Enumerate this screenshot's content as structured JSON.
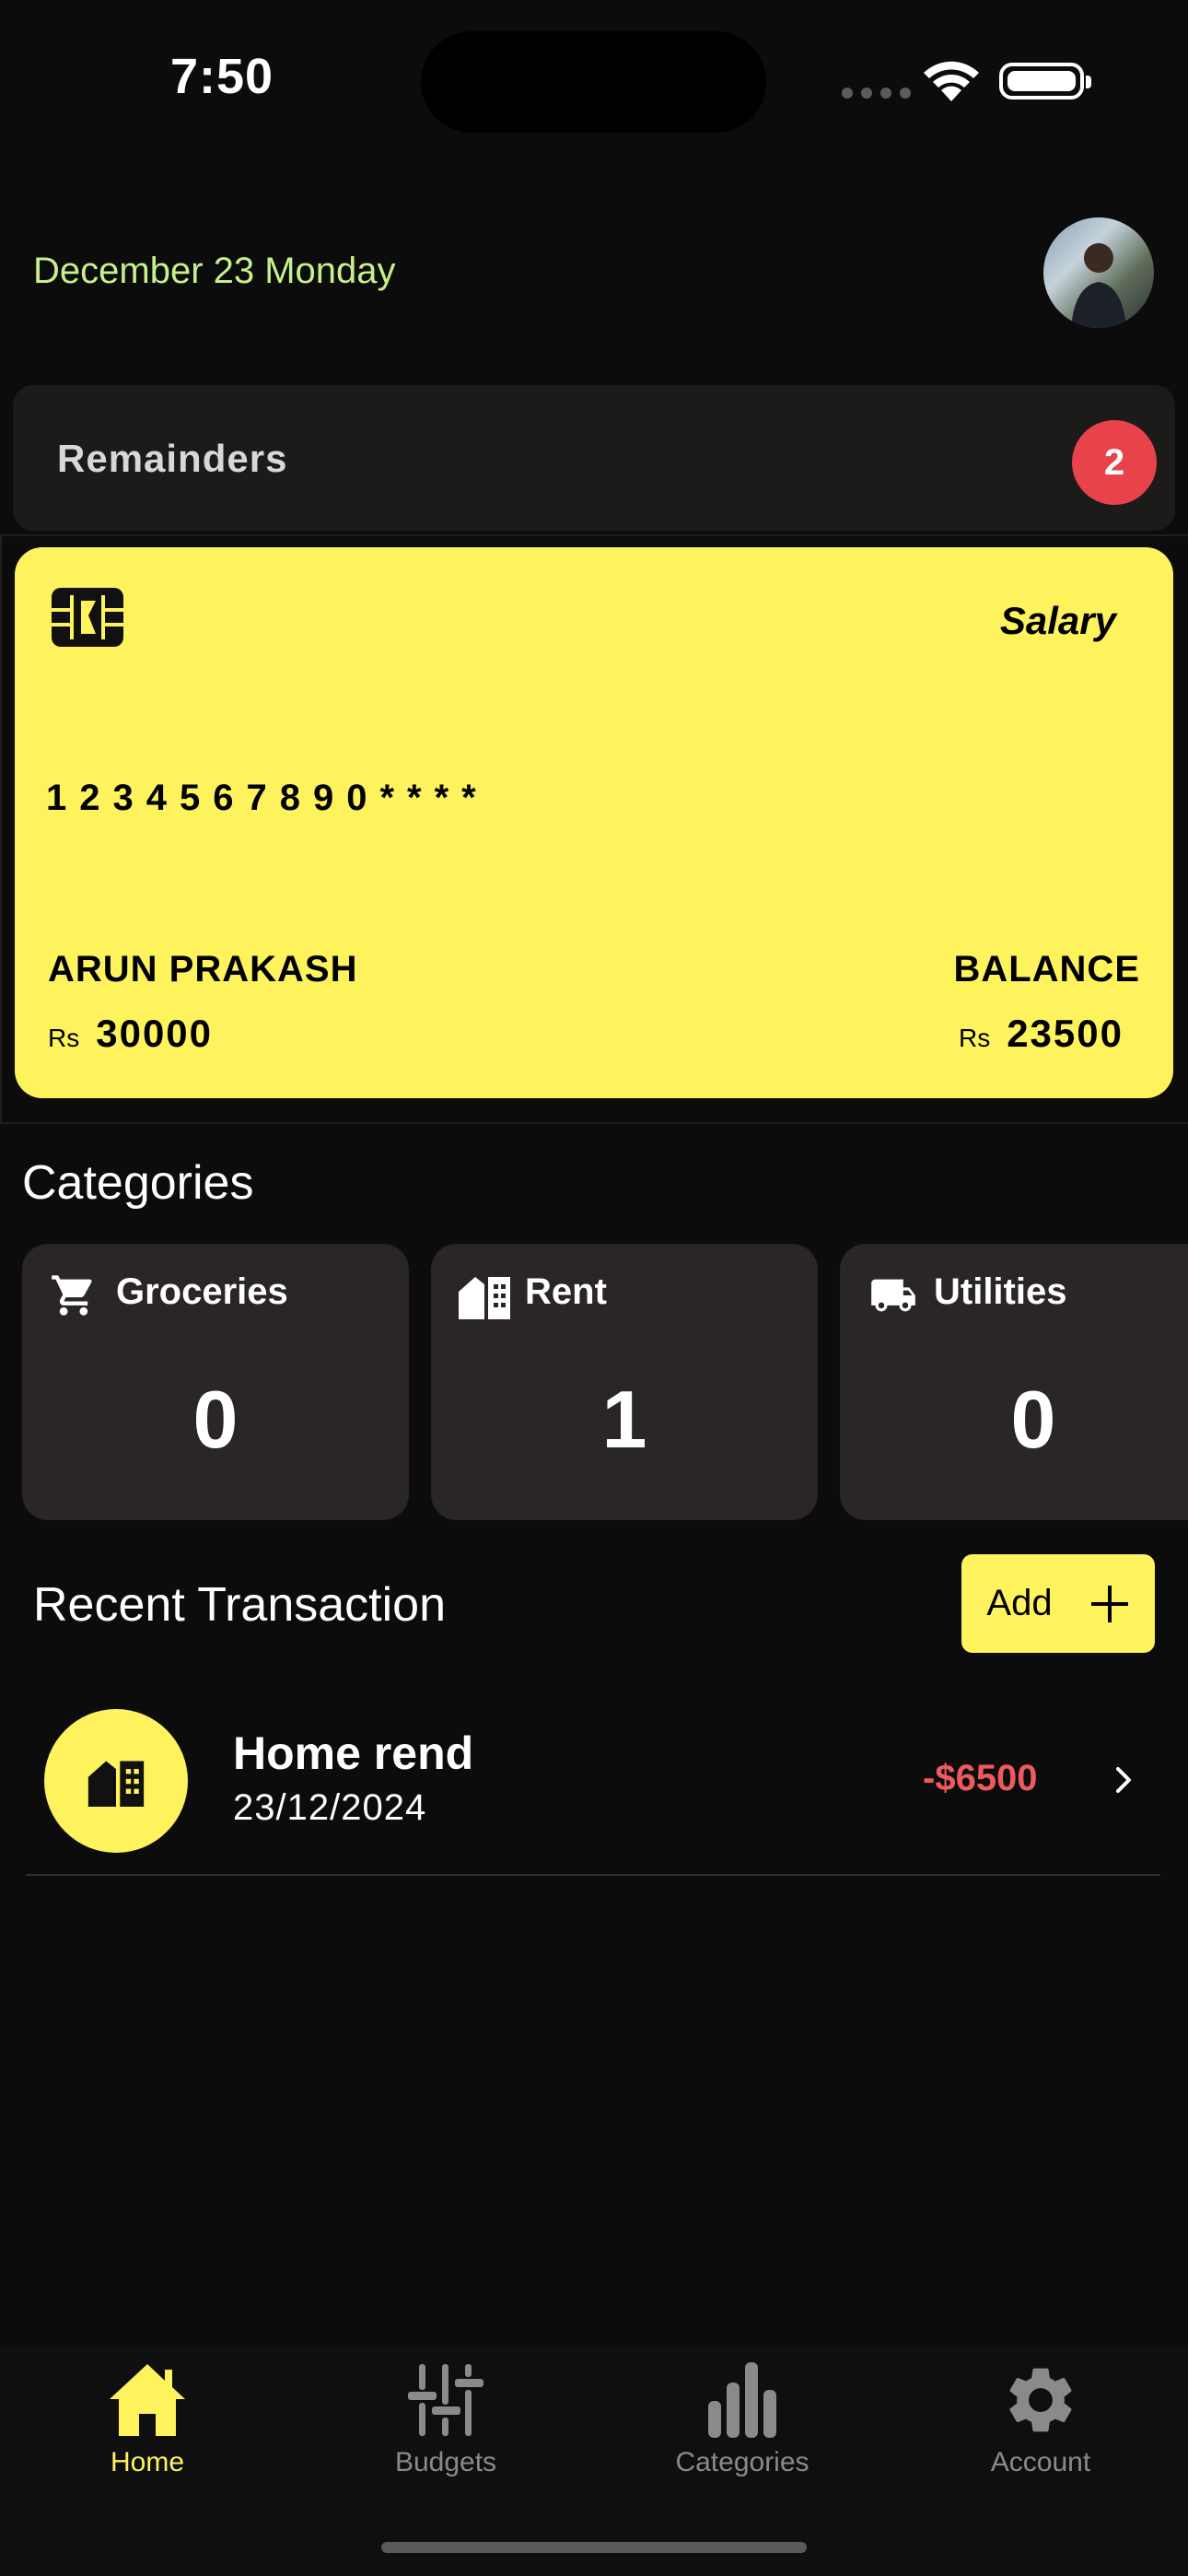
{
  "status_bar": {
    "time": "7:50"
  },
  "header": {
    "date": "December 23 Monday"
  },
  "reminders": {
    "label": "Remainders",
    "count": "2"
  },
  "card": {
    "type": "Salary",
    "number": "1234567890****",
    "holder": "ARUN PRAKASH",
    "balance_label": "BALANCE",
    "currency_symbol": "Rs",
    "salary_amount": "30000",
    "balance_amount": "23500",
    "color": "#fef35d"
  },
  "categories": {
    "title": "Categories",
    "items": [
      {
        "name": "Groceries",
        "count": "0",
        "icon": "cart-icon"
      },
      {
        "name": "Rent",
        "count": "1",
        "icon": "building-icon"
      },
      {
        "name": "Utilities",
        "count": "0",
        "icon": "truck-icon"
      }
    ]
  },
  "recent": {
    "title": "Recent Transaction",
    "add_label": "Add",
    "transactions": [
      {
        "title": "Home rend",
        "date": "23/12/2024",
        "amount": "-$6500",
        "icon": "building-icon"
      }
    ]
  },
  "nav": {
    "items": [
      {
        "label": "Home",
        "icon": "home-icon",
        "active": true
      },
      {
        "label": "Budgets",
        "icon": "sliders-icon",
        "active": false
      },
      {
        "label": "Categories",
        "icon": "bar-chart-icon",
        "active": false
      },
      {
        "label": "Account",
        "icon": "gear-icon",
        "active": false
      }
    ]
  },
  "colors": {
    "accent": "#fef35d",
    "date_text": "#c7f08a",
    "badge": "#e8424a",
    "negative": "#ef5a5f",
    "background": "#0c0c0c"
  }
}
